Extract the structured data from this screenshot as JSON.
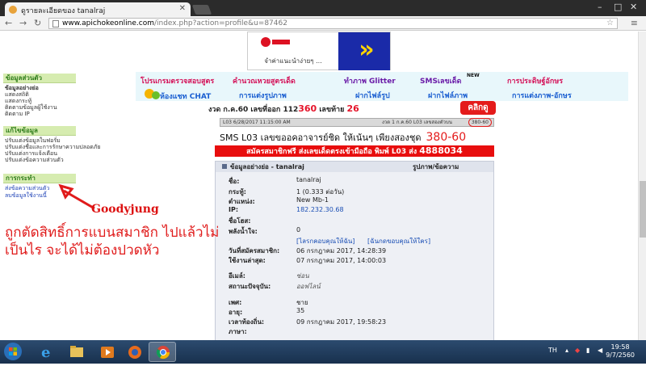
{
  "browser": {
    "tab_title": "ดูรายละเอียดของ tanalraj",
    "url_domain": "www.apichokeonline.com",
    "url_path": "/index.php?action=profile&u=87462"
  },
  "banner": {
    "caption": "จำค่าแนะนำง่ายๆ ..."
  },
  "sidebar": {
    "sections": [
      {
        "title": "ข้อมูลส่วนตัว",
        "items": [
          "ข้อมูลอย่างย่อ",
          "แสดงสถิติ",
          "แสดงกระทู้",
          "ติดตามข้อมูลผู้ใช้งาน",
          "ติดตาม IP"
        ]
      },
      {
        "title": "แก้ไขข้อมูล",
        "items": [
          "ปรับแต่งข้อมูลในฟอรั่ม",
          "ปรับแต่งชื่อและการรักษาความปลอดภัย",
          "ปรับแต่งการแจ้งเตือน",
          "ปรับแต่งข้อความส่วนตัว"
        ]
      },
      {
        "title": "การกระทำ",
        "items": [
          "ส่งข้อความส่วนตัว",
          "ลบข้อมูลใช้งานนี้"
        ]
      }
    ]
  },
  "menu": {
    "row1": [
      "โปรแกรมตรวจสอบสูตร",
      "คำนวณหวยสูตรเด็ด",
      "ทำภาพ Glitter",
      "SMSเลขเด็ด",
      "การประดิษฐ์อักษร"
    ],
    "row2": [
      "ห้องแชท CHAT",
      "การแต่งรูปภาพ",
      "ฝากไฟล์รูป",
      "ฝากไฟล์ภาพ",
      "การแต่งภาพ-อักษร"
    ],
    "new_badge": "NEW"
  },
  "lotto": {
    "prefix": "งวด ก.ค.60 เลขที่ออก 112",
    "highlight": "360",
    "suffix": " เลขท้าย ",
    "last": "26"
  },
  "click_button": "คลิกดู",
  "gray_row": {
    "left": "L03   6/28/2017 11:15:00 AM",
    "mid": "งวด 1 ก.ค.60 L03 เลขสองตัวบน",
    "code": "380-60"
  },
  "sms": {
    "text": "SMS L03 เลขขออคอาจารย์ชิด ให้เน้นๆ เพียงสองชุด",
    "code": "380-60"
  },
  "red_bar": {
    "text": "สมัครสมาชิกฟรี ส่งเลขเด็ดตรงเข้ามือถือ พิมพ์ L03 ส่ง ",
    "number": "4888034"
  },
  "profile": {
    "header": "ข้อมูลอย่างย่อ - tanalraj",
    "header_right": "รูปภาพ/ข้อความ",
    "rows": [
      {
        "label": "ชื่อ:",
        "value": "tanalraj"
      },
      {
        "label": "กระทู้:",
        "value": "1 (0.333 ต่อวัน)"
      },
      {
        "label": "ตำแหน่ง:",
        "value": "New Mb-1"
      },
      {
        "label": "IP:",
        "value": "182.232.30.68"
      },
      {
        "label": "ชื่อโฮส:",
        "value": ""
      },
      {
        "label": "พลังน้ำใจ:",
        "value": "0"
      },
      {
        "label": "",
        "value": "[ไลรกคอบคุณให้ฉัน]",
        "value2": "[ฉันกดขอบคุณให้ใคร]"
      },
      {
        "label": "วันที่สมัครสมาชิก:",
        "value": "06 กรกฎาคม 2017, 14:28:39"
      },
      {
        "label": "ใช้งานล่าสุด:",
        "value": "07 กรกฎาคม 2017, 14:00:03"
      },
      {
        "label": "อีเมล์:",
        "value": "ซ่อน"
      },
      {
        "label": "สถานะปัจจุบัน:",
        "value": "ออฟไลน์"
      },
      {
        "label": "เพศ:",
        "value": "ชาย"
      },
      {
        "label": "อายุ:",
        "value": "35"
      },
      {
        "label": "เวลาท้องถิ่น:",
        "value": "09 กรกฎาคม 2017, 19:58:23"
      },
      {
        "label": "ภาษา:",
        "value": ""
      },
      {
        "label": "ลายเซ็น:",
        "value": ""
      }
    ]
  },
  "annotation": {
    "name": "Goodyjung",
    "text": "ถูกตัดสิทธิ์การแบนสมาชิก ไปแล้วไม่เป็นไร จะได้ไม่ต้องปวดหัว"
  },
  "taskbar": {
    "lang": "TH",
    "time": "19:58",
    "date": "9/7/2560"
  }
}
